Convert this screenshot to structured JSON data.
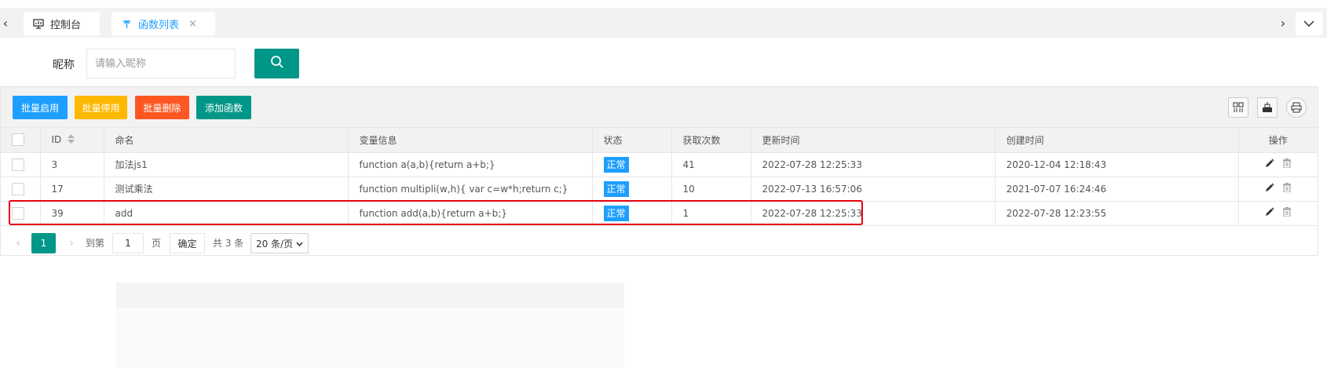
{
  "tabs": {
    "console_label": "控制台",
    "functions_label": "函数列表",
    "close_symbol": "×"
  },
  "search": {
    "label": "昵称",
    "placeholder": "请输入昵称"
  },
  "toolbar": {
    "batch_enable": "批量启用",
    "batch_disable": "批量停用",
    "batch_delete": "批量删除",
    "add_function": "添加函数"
  },
  "table": {
    "headers": {
      "id": "ID",
      "name": "命名",
      "vars": "变量信息",
      "status": "状态",
      "count": "获取次数",
      "updated": "更新时间",
      "created": "创建时间",
      "ops": "操作"
    },
    "rows": [
      {
        "id": "3",
        "name": "加法js1",
        "vars": "function a(a,b){return a+b;}",
        "status": "正常",
        "count": "41",
        "updated": "2022-07-28 12:25:33",
        "created": "2020-12-04 12:18:43"
      },
      {
        "id": "17",
        "name": "测试乘法",
        "vars": "function multipli(w,h){ var c=w*h;return c;}",
        "status": "正常",
        "count": "10",
        "updated": "2022-07-13 16:57:06",
        "created": "2021-07-07 16:24:46"
      },
      {
        "id": "39",
        "name": "add",
        "vars": "function add(a,b){return a+b;}",
        "status": "正常",
        "count": "1",
        "updated": "2022-07-28 12:25:33",
        "created": "2022-07-28 12:23:55"
      }
    ]
  },
  "pager": {
    "current": "1",
    "goto_label": "到第",
    "goto_value": "1",
    "page_label": "页",
    "ok_label": "确定",
    "total_label": "共 3 条",
    "page_size": "20 条/页"
  },
  "colors": {
    "primary": "#009688",
    "blue": "#1e9fff",
    "warm": "#ffb800",
    "danger": "#ff5722",
    "highlight": "#e60012"
  }
}
